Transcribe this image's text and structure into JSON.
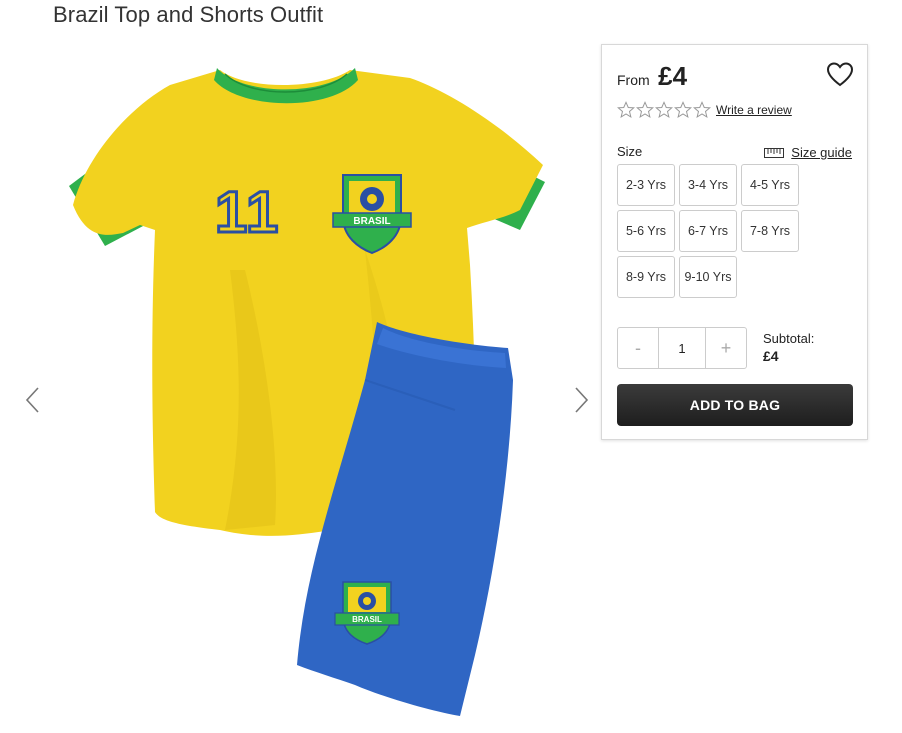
{
  "product": {
    "title": "Brazil Top and Shorts Outfit",
    "price_prefix": "From",
    "price": "£4",
    "jersey_number": "11",
    "badge_text": "BRASIL"
  },
  "rating": {
    "stars_filled": 0,
    "stars_total": 5,
    "write_review_label": "Write a review"
  },
  "size": {
    "label": "Size",
    "guide_label": "Size guide",
    "options": [
      "2-3 Yrs",
      "3-4 Yrs",
      "4-5 Yrs",
      "5-6 Yrs",
      "6-7 Yrs",
      "7-8 Yrs",
      "8-9 Yrs",
      "9-10 Yrs"
    ]
  },
  "quantity": {
    "decrement_label": "-",
    "value": "1",
    "increment_label": "+"
  },
  "subtotal": {
    "label": "Subtotal:",
    "value": "£4"
  },
  "cta": {
    "add_to_bag_label": "ADD TO BAG"
  },
  "icons": {
    "wishlist": "heart-icon",
    "prev": "chevron-left-icon",
    "next": "chevron-right-icon",
    "size_guide": "ruler-icon",
    "star": "star-outline-icon"
  },
  "colors": {
    "shirt_yellow": "#f2d21f",
    "collar_green": "#2fb04c",
    "shorts_blue": "#2f66c4",
    "button_dark": "#262626"
  }
}
